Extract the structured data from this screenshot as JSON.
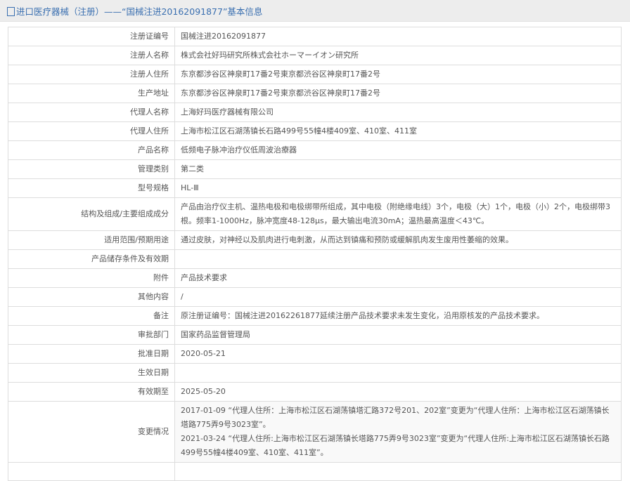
{
  "header": {
    "title": "进口医疗器械（注册）——“国械注进20162091877”基本信息"
  },
  "rows": [
    {
      "label": "注册证编号",
      "value": "国械注进20162091877"
    },
    {
      "label": "注册人名称",
      "value": "株式会社好玛研究所株式会社ホーマーイオン研究所"
    },
    {
      "label": "注册人住所",
      "value": "东京都涉谷区神泉町17番2号東京都渋谷区神泉町17番2号"
    },
    {
      "label": "生产地址",
      "value": "东京都涉谷区神泉町17番2号東京都渋谷区神泉町17番2号"
    },
    {
      "label": "代理人名称",
      "value": "上海好玛医疗器械有限公司"
    },
    {
      "label": "代理人住所",
      "value": "上海市松江区石湖荡镇长石路499号55幢4楼409室、410室、411室"
    },
    {
      "label": "产品名称",
      "value": "低频电子脉冲治疗仪低周波治療器"
    },
    {
      "label": "管理类别",
      "value": "第二类"
    },
    {
      "label": "型号规格",
      "value": "HL-Ⅲ"
    },
    {
      "label": "结构及组成/主要组成成分",
      "value": "产品由治疗仪主机、温热电极和电极绑带所组成，其中电极（附绝缘电线）3个，电极（大）1个，电极（小）2个，电极绑带3根。频率1-1000Hz，脉冲宽度48-128μs，最大输出电流30mA；温热最高温度＜43℃。"
    },
    {
      "label": "适用范围/预期用途",
      "value": "通过皮肤，对神经以及肌肉进行电刺激，从而达到镇痛和预防或缓解肌肉发生废用性萎缩的效果。"
    },
    {
      "label": "产品储存条件及有效期",
      "value": ""
    },
    {
      "label": "附件",
      "value": "产品技术要求"
    },
    {
      "label": "其他内容",
      "value": "/"
    },
    {
      "label": "备注",
      "value": "原注册证编号：国械注进20162261877延续注册产品技术要求未发生变化，沿用原核发的产品技术要求。"
    },
    {
      "label": "审批部门",
      "value": "国家药品监督管理局"
    },
    {
      "label": "批准日期",
      "value": "2020-05-21"
    },
    {
      "label": "生效日期",
      "value": ""
    },
    {
      "label": "有效期至",
      "value": "2025-05-20"
    }
  ],
  "changes": {
    "label": "变更情况",
    "lines": [
      "2017-01-09 “代理人住所：上海市松江区石湖荡镇塔汇路372号201、202室”变更为“代理人住所：上海市松江区石湖荡镇长塔路775弄9号3023室”。",
      "2021-03-24 “代理人住所:上海市松江区石湖荡镇长塔路775弄9号3023室”变更为“代理人住所:上海市松江区石湖荡镇长石路499号55幢4楼409室、410室、411室”。"
    ]
  }
}
